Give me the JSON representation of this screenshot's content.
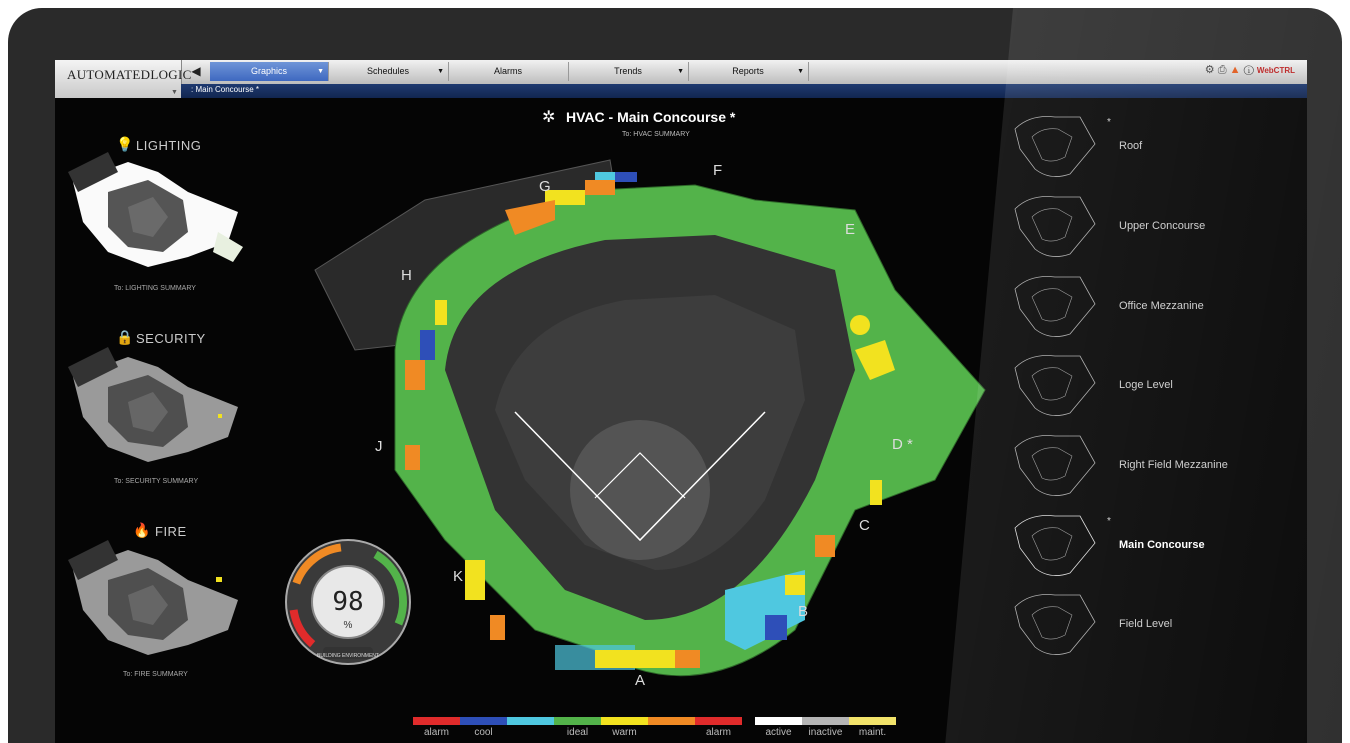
{
  "app": {
    "logo": "AUTOMATEDLOGIC",
    "logo_mark": "®"
  },
  "menu": [
    {
      "label": "Graphics"
    },
    {
      "label": "Schedules"
    },
    {
      "label": "Alarms"
    },
    {
      "label": "Trends"
    },
    {
      "label": "Reports"
    }
  ],
  "toolbar": {
    "webctrl": "WebCTRL"
  },
  "breadcrumb": ": Main Concourse *",
  "header": {
    "title": "HVAC  -  Main Concourse *",
    "subtitle": "To: HVAC SUMMARY"
  },
  "left_panels": [
    {
      "label": "LIGHTING",
      "link": "To: LIGHTING SUMMARY",
      "icon": "bulb-icon"
    },
    {
      "label": "SECURITY",
      "link": "To: SECURITY SUMMARY",
      "icon": "lock-icon"
    },
    {
      "label": "FIRE",
      "link": "To: FIRE SUMMARY",
      "icon": "flame-icon"
    }
  ],
  "levels": [
    {
      "label": "Roof",
      "star": "*"
    },
    {
      "label": "Upper Concourse"
    },
    {
      "label": "Office Mezzanine"
    },
    {
      "label": "Loge Level"
    },
    {
      "label": "Right Field Mezzanine"
    },
    {
      "label": "Main Concourse",
      "star": "*"
    },
    {
      "label": "Field Level"
    }
  ],
  "zones": [
    "A",
    "B",
    "C",
    "D *",
    "E",
    "F",
    "G",
    "H",
    "J",
    "K"
  ],
  "gauge": {
    "value": "98",
    "unit": "%",
    "caption": "BUILDING ENVIRONMENT"
  },
  "legend": [
    {
      "label": "alarm",
      "color": "#e02b2b"
    },
    {
      "label": "cool",
      "color": "#2e4fb8"
    },
    {
      "label": "",
      "color": "#4fc8e0"
    },
    {
      "label": "ideal",
      "color": "#53b34a"
    },
    {
      "label": "warm",
      "color": "#f2e21f"
    },
    {
      "label": "",
      "color": "#f08a24"
    },
    {
      "label": "alarm",
      "color": "#e02b2b"
    },
    {
      "label": "active",
      "color": "#ffffff"
    },
    {
      "label": "inactive",
      "color": "#b5b5b5"
    },
    {
      "label": "maint.",
      "color": "#f2e36a"
    }
  ]
}
